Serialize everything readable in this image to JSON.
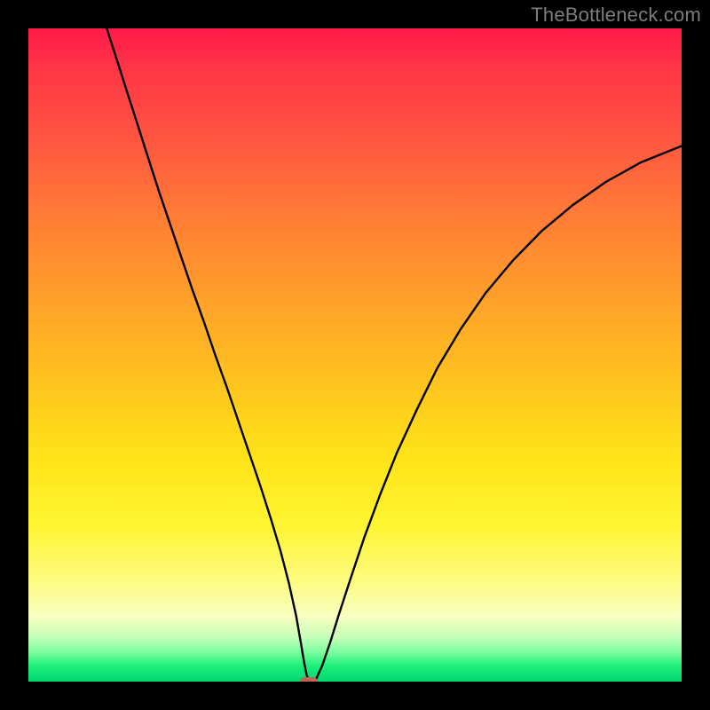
{
  "watermark": "TheBottleneck.com",
  "chart_data": {
    "type": "line",
    "title": "",
    "xlabel": "",
    "ylabel": "",
    "xlim": [
      0,
      100
    ],
    "ylim": [
      0,
      100
    ],
    "legend": false,
    "cusp": {
      "x": 43,
      "y": 0
    },
    "background_gradient": {
      "stops": [
        {
          "pos": 0,
          "color": "#ff1a49"
        },
        {
          "pos": 0.18,
          "color": "#ff5940"
        },
        {
          "pos": 0.42,
          "color": "#ffa229"
        },
        {
          "pos": 0.66,
          "color": "#ffe418"
        },
        {
          "pos": 0.84,
          "color": "#fdfb7a"
        },
        {
          "pos": 0.93,
          "color": "#c9ffb9"
        },
        {
          "pos": 1.0,
          "color": "#00d670"
        }
      ]
    },
    "left_branch": [
      {
        "x": 12.0,
        "y": 100.0
      },
      {
        "x": 13.6,
        "y": 95.0
      },
      {
        "x": 15.2,
        "y": 90.0
      },
      {
        "x": 16.8,
        "y": 85.0
      },
      {
        "x": 18.4,
        "y": 80.0
      },
      {
        "x": 20.0,
        "y": 75.0
      },
      {
        "x": 21.7,
        "y": 70.0
      },
      {
        "x": 23.4,
        "y": 65.0
      },
      {
        "x": 25.1,
        "y": 60.0
      },
      {
        "x": 26.9,
        "y": 55.0
      },
      {
        "x": 28.6,
        "y": 50.0
      },
      {
        "x": 30.4,
        "y": 45.0
      },
      {
        "x": 32.1,
        "y": 40.0
      },
      {
        "x": 33.8,
        "y": 35.0
      },
      {
        "x": 35.5,
        "y": 30.0
      },
      {
        "x": 37.1,
        "y": 25.0
      },
      {
        "x": 38.6,
        "y": 20.0
      },
      {
        "x": 39.9,
        "y": 15.0
      },
      {
        "x": 41.0,
        "y": 10.0
      },
      {
        "x": 41.7,
        "y": 6.0
      },
      {
        "x": 42.2,
        "y": 3.0
      },
      {
        "x": 42.6,
        "y": 1.0
      },
      {
        "x": 43.0,
        "y": 0.0
      }
    ],
    "right_branch": [
      {
        "x": 43.0,
        "y": 0.0
      },
      {
        "x": 43.4,
        "y": 0.0
      },
      {
        "x": 44.1,
        "y": 0.5
      },
      {
        "x": 45.0,
        "y": 2.5
      },
      {
        "x": 46.2,
        "y": 6.0
      },
      {
        "x": 47.6,
        "y": 10.5
      },
      {
        "x": 49.4,
        "y": 16.0
      },
      {
        "x": 51.4,
        "y": 22.0
      },
      {
        "x": 53.8,
        "y": 28.5
      },
      {
        "x": 56.4,
        "y": 35.0
      },
      {
        "x": 59.4,
        "y": 41.5
      },
      {
        "x": 62.6,
        "y": 48.0
      },
      {
        "x": 66.2,
        "y": 54.0
      },
      {
        "x": 70.0,
        "y": 59.5
      },
      {
        "x": 74.2,
        "y": 64.5
      },
      {
        "x": 78.6,
        "y": 69.0
      },
      {
        "x": 83.4,
        "y": 73.0
      },
      {
        "x": 88.4,
        "y": 76.5
      },
      {
        "x": 93.8,
        "y": 79.5
      },
      {
        "x": 100.0,
        "y": 82.0
      }
    ],
    "marker": {
      "x": 43,
      "y": 0,
      "color": "#c26258"
    }
  }
}
